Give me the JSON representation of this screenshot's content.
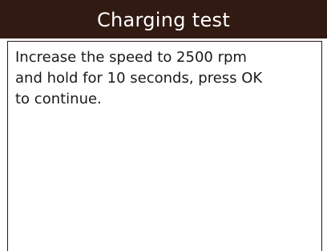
{
  "screen": {
    "title": "Charging test",
    "message": "Increase the speed to 2500 rpm\nand hold for 10 seconds, press OK\nto continue."
  },
  "colors": {
    "title_bar_background": "#311a12",
    "title_text": "#ffffff",
    "body_text": "#1a1a1a",
    "panel_border": "#2a1a14"
  }
}
